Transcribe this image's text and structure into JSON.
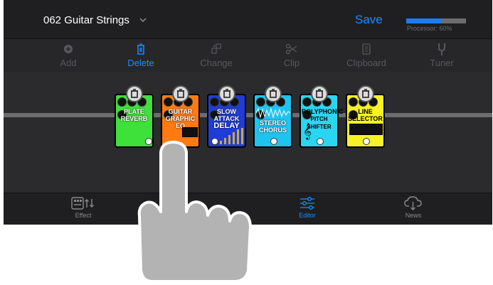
{
  "header": {
    "preset_name": "062 Guitar Strings",
    "save_label": "Save",
    "processor_label": "Processor: 60%",
    "processor_level": 0.6
  },
  "toolbar": {
    "items": [
      {
        "label": "Add",
        "icon": "plus-circle-icon",
        "active": false
      },
      {
        "label": "Delete",
        "icon": "trash-icon",
        "active": true
      },
      {
        "label": "Change",
        "icon": "swap-icon",
        "active": false
      },
      {
        "label": "Clip",
        "icon": "scissors-icon",
        "active": false
      },
      {
        "label": "Clipboard",
        "icon": "clipboard-icon",
        "active": false
      },
      {
        "label": "Tuner",
        "icon": "tuning-fork-icon",
        "active": false
      }
    ]
  },
  "pedals": [
    {
      "line1": "PLATE",
      "line2": "REVERB",
      "color": "#3ee03a"
    },
    {
      "line1": "GUITAR",
      "line2": "GRAPHIC EQ",
      "color": "#ff7b12"
    },
    {
      "line1": "SLOW ATTACK",
      "line2": "DELAY",
      "color": "#1f3dd6"
    },
    {
      "line1": "STEREO",
      "line2": "CHORUS",
      "color": "#1ec4f0"
    },
    {
      "line1": "POLYPHONIC",
      "line2": "PITCH SHIFTER",
      "color": "#29d6f2"
    },
    {
      "line1": "LINE",
      "line2": "SELECTOR",
      "color": "#f7f225"
    }
  ],
  "tabbar": {
    "items": [
      {
        "label": "Effect",
        "icon": "effect-icon",
        "active": false
      },
      {
        "label": "Editor",
        "icon": "sliders-icon",
        "active": true
      },
      {
        "label": "News",
        "icon": "cloud-download-icon",
        "active": false
      }
    ]
  },
  "colors": {
    "accent": "#1c8cff",
    "background": "#1c1c1e"
  }
}
